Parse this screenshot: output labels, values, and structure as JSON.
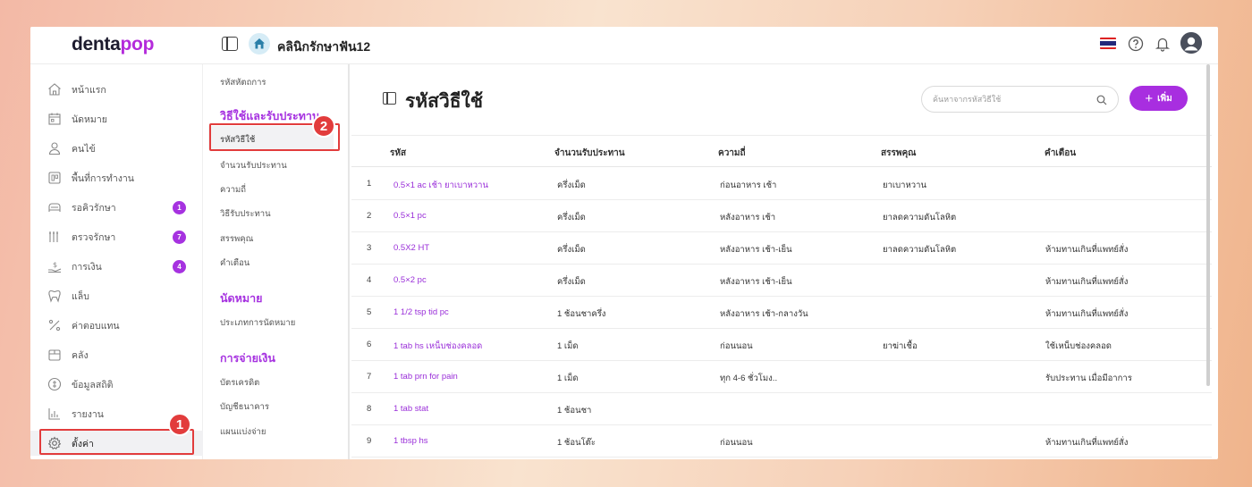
{
  "app": {
    "logo_main": "denta",
    "logo_accent": "pop",
    "clinic_name": "คลินิกรักษาฟัน12"
  },
  "sidebar": {
    "items": [
      {
        "label": "หน้าแรก",
        "icon": "home-icon",
        "badge": ""
      },
      {
        "label": "นัดหมาย",
        "icon": "calendar-icon",
        "badge": ""
      },
      {
        "label": "คนไข้",
        "icon": "person-icon",
        "badge": ""
      },
      {
        "label": "พื้นที่การทำงาน",
        "icon": "workspace-icon",
        "badge": ""
      },
      {
        "label": "รอคิวรักษา",
        "icon": "dental-chair-icon",
        "badge": "1"
      },
      {
        "label": "ตรวจรักษา",
        "icon": "dental-tools-icon",
        "badge": "7"
      },
      {
        "label": "การเงิน",
        "icon": "money-hand-icon",
        "badge": "4"
      },
      {
        "label": "แล็บ",
        "icon": "tooth-icon",
        "badge": ""
      },
      {
        "label": "ค่าตอบแทน",
        "icon": "percent-icon",
        "badge": ""
      },
      {
        "label": "คลัง",
        "icon": "box-icon",
        "badge": ""
      },
      {
        "label": "ข้อมูลสถิติ",
        "icon": "stats-circle-icon",
        "badge": ""
      },
      {
        "label": "รายงาน",
        "icon": "bar-chart-icon",
        "badge": ""
      },
      {
        "label": "ตั้งค่า",
        "icon": "gear-icon",
        "badge": ""
      }
    ],
    "active": "ตั้งค่า"
  },
  "submenu": {
    "top_item": "รหัสหัตถการ",
    "section1_title": "วิธีใช้และรับประทาน",
    "section1_items": [
      "รหัสวิธีใช้",
      "จำนวนรับประทาน",
      "ความถี่",
      "วิธีรับประทาน",
      "สรรพคุณ",
      "คำเตือน"
    ],
    "section2_title": "นัดหมาย",
    "section2_items": [
      "ประเภทการนัดหมาย"
    ],
    "section3_title": "การจ่ายเงิน",
    "section3_items": [
      "บัตรเครดิต",
      "บัญชีธนาคาร",
      "แผนแบ่งจ่าย"
    ],
    "active": "รหัสวิธีใช้"
  },
  "annotations": {
    "step1": "1",
    "step2": "2"
  },
  "main": {
    "title": "รหัสวิธีใช้",
    "search_placeholder": "ค้นหาจากรหัสวิธีใช้",
    "add_label": "เพิ่ม",
    "add_icon": "plus-icon",
    "columns": [
      "รหัส",
      "จำนวนรับประทาน",
      "ความถี่",
      "สรรพคุณ",
      "คำเตือน"
    ],
    "rows": [
      {
        "n": "1",
        "code": "0.5×1 ac เช้า ยาเบาหวาน",
        "amount": "ครึ่งเม็ด",
        "freq": "ก่อนอาหาร เช้า",
        "prop": "ยาเบาหวาน",
        "warn": ""
      },
      {
        "n": "2",
        "code": "0.5×1 pc",
        "amount": "ครึ่งเม็ด",
        "freq": "หลังอาหาร เช้า",
        "prop": "ยาลดความดันโลหิต",
        "warn": ""
      },
      {
        "n": "3",
        "code": "0.5X2 HT",
        "amount": "ครึ่งเม็ด",
        "freq": "หลังอาหาร เช้า-เย็น",
        "prop": "ยาลดความดันโลหิต",
        "warn": "ห้ามทานเกินที่แพทย์สั่ง"
      },
      {
        "n": "4",
        "code": "0.5×2 pc",
        "amount": "ครึ่งเม็ด",
        "freq": "หลังอาหาร เช้า-เย็น",
        "prop": "",
        "warn": "ห้ามทานเกินที่แพทย์สั่ง"
      },
      {
        "n": "5",
        "code": "1 1/2 tsp tid pc",
        "amount": "1 ช้อนชาครึ่ง",
        "freq": "หลังอาหาร เช้า-กลางวัน",
        "prop": "",
        "warn": "ห้ามทานเกินที่แพทย์สั่ง"
      },
      {
        "n": "6",
        "code": "1 tab hs เหน็บช่องคลอด",
        "amount": "1 เม็ด",
        "freq": "ก่อนนอน",
        "prop": "ยาฆ่าเชื้อ",
        "warn": "ใช้เหน็บช่องคลอด"
      },
      {
        "n": "7",
        "code": "1 tab prn for pain",
        "amount": "1 เม็ด",
        "freq": "ทุก 4-6 ชั่วโมง..",
        "prop": "",
        "warn": "รับประทาน เมื่อมีอาการ"
      },
      {
        "n": "8",
        "code": "1 tab stat",
        "amount": "1 ช้อนชา",
        "freq": "",
        "prop": "",
        "warn": ""
      },
      {
        "n": "9",
        "code": "1 tbsp hs",
        "amount": "1 ช้อนโต๊ะ",
        "freq": "ก่อนนอน",
        "prop": "",
        "warn": "ห้ามทานเกินที่แพทย์สั่ง"
      }
    ]
  },
  "colors": {
    "accent": "#a632e0",
    "highlight": "#e23c3c"
  }
}
